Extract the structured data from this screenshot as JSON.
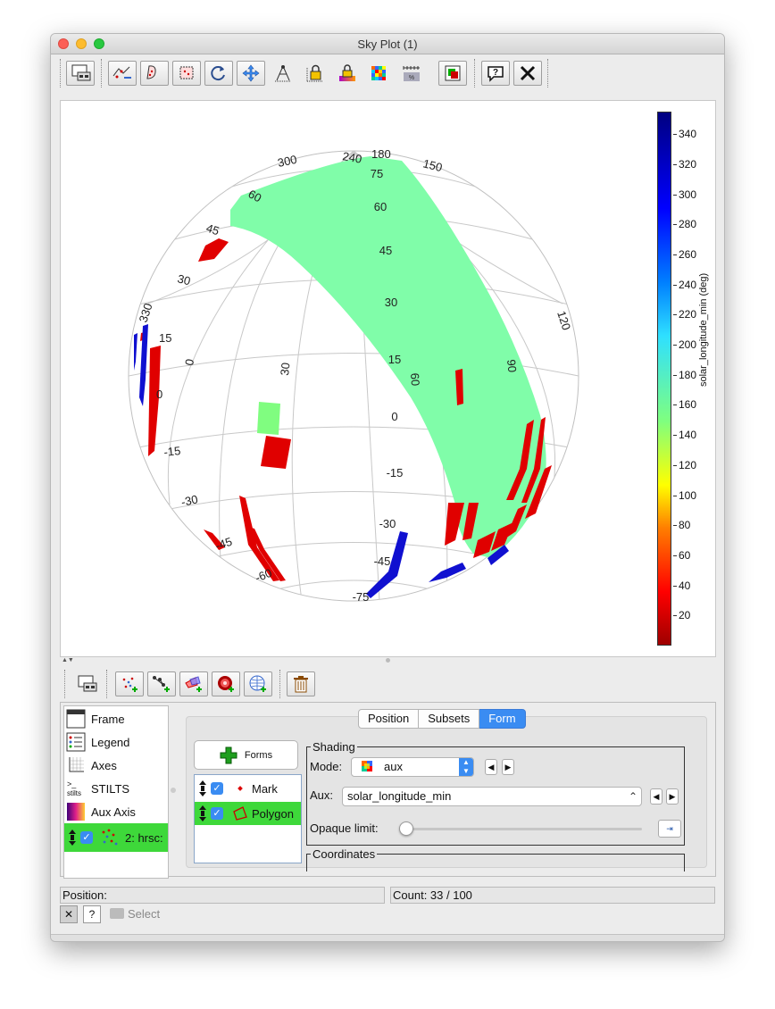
{
  "window": {
    "title": "Sky Plot (1)"
  },
  "toolbar": {
    "icons": [
      "frame-icon",
      "zoom-x-icon",
      "zoom-y-icon",
      "zoom-box-icon",
      "resize-icon",
      "navigate-icon",
      "axis-lock-icon",
      "aux-lock-icon",
      "aux-lock-color-icon",
      "hpx-grid-icon",
      "aux-scale-icon",
      "export-icon",
      "help-icon",
      "close-icon"
    ]
  },
  "plot": {
    "lon_labels": [
      "300",
      "240",
      "180",
      "150",
      "120",
      "90",
      "60",
      "30",
      "0",
      "330"
    ],
    "lat_labels_left": [
      "60",
      "45",
      "30",
      "15",
      "0",
      "-15",
      "-30",
      "-45",
      "-60"
    ],
    "lat_labels_center": [
      "75",
      "60",
      "45",
      "30",
      "15",
      "0",
      "-15",
      "-30",
      "-45",
      "-75"
    ],
    "colors": {
      "low": "#e00000",
      "mid": "#80ffaa",
      "high": "#0000c0",
      "grid": "#c8c8c8"
    }
  },
  "colorbar": {
    "title": "solar_longitude_min (deg)",
    "min": 0,
    "max": 355,
    "ticks": [
      "340",
      "320",
      "300",
      "280",
      "260",
      "240",
      "220",
      "200",
      "180",
      "160",
      "140",
      "120",
      "100",
      "80",
      "60",
      "40",
      "20"
    ]
  },
  "layer_toolbar": {
    "icons": [
      "frame-small-icon",
      "add-position-plot-icon",
      "add-pair-plot-icon",
      "add-area-plot-icon",
      "add-density-plot-icon",
      "add-sky-grid-icon",
      "delete-layer-icon"
    ]
  },
  "controls": [
    {
      "label": "Frame",
      "icon": "title-frame-icon"
    },
    {
      "label": "Legend",
      "icon": "legend-icon"
    },
    {
      "label": "Axes",
      "icon": "axes-icon"
    },
    {
      "label": "STILTS",
      "icon": "stilts-icon"
    },
    {
      "label": "Aux Axis",
      "icon": "aux-axis-icon"
    },
    {
      "label": "2: hrsc:",
      "icon": "layer-icon",
      "checked": true
    }
  ],
  "tabs": [
    "Position",
    "Subsets",
    "Form"
  ],
  "active_tab": "Form",
  "forms": {
    "button_label": "Forms",
    "items": [
      {
        "label": "Mark",
        "checked": true,
        "selected": false
      },
      {
        "label": "Polygon",
        "checked": true,
        "selected": true
      }
    ]
  },
  "shading": {
    "title": "Shading",
    "mode_label": "Mode:",
    "mode_value": "aux",
    "aux_label": "Aux:",
    "aux_value": "solar_longitude_min",
    "opaque_label": "Opaque limit:",
    "opaque_value": 0
  },
  "coordinates": {
    "title": "Coordinates"
  },
  "status": {
    "position_label": "Position:",
    "count_label": "Count: 33 / 100"
  },
  "bottom": {
    "close_glyph": "✕",
    "help_glyph": "?",
    "select_label": "Select"
  }
}
